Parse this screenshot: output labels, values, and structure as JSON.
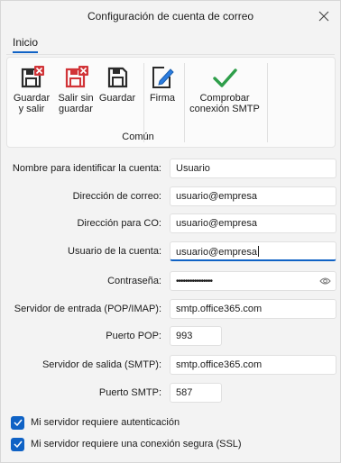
{
  "window": {
    "title": "Configuración de cuenta de correo"
  },
  "tabs": [
    {
      "label": "Inicio"
    }
  ],
  "ribbon": {
    "buttons": [
      {
        "label": "Guardar\ny salir",
        "icon": "save-close-icon"
      },
      {
        "label": "Salir sin\nguardar",
        "icon": "exit-no-save-icon"
      },
      {
        "label": "Guardar",
        "icon": "save-icon"
      },
      {
        "label": "Firma",
        "icon": "signature-icon"
      },
      {
        "label": "Comprobar\nconexión SMTP",
        "icon": "check-icon"
      }
    ],
    "group_label": "Común"
  },
  "form": {
    "account_name_label": "Nombre para identificar la cuenta:",
    "account_name_value": "Usuario",
    "email_label": "Dirección de correo:",
    "email_value": "usuario@empresa",
    "cc_label": "Dirección para CO:",
    "cc_value": "usuario@empresa",
    "username_label": "Usuario de la cuenta:",
    "username_value": "usuario@empresa",
    "password_label": "Contraseña:",
    "password_value": "••••••••••••••••",
    "incoming_label": "Servidor de entrada (POP/IMAP):",
    "incoming_value": "smtp.office365.com",
    "pop_port_label": "Puerto POP:",
    "pop_port_value": "993",
    "outgoing_label": "Servidor de salida (SMTP):",
    "outgoing_value": "smtp.office365.com",
    "smtp_port_label": "Puerto SMTP:",
    "smtp_port_value": "587"
  },
  "checkboxes": [
    {
      "label": "Mi servidor requiere autenticación",
      "checked": true
    },
    {
      "label": "Mi servidor requiere una conexión segura (SSL)",
      "checked": true
    }
  ],
  "colors": {
    "accent": "#0f62c5",
    "red_badge": "#d13438",
    "check_green": "#2e9e4a"
  }
}
